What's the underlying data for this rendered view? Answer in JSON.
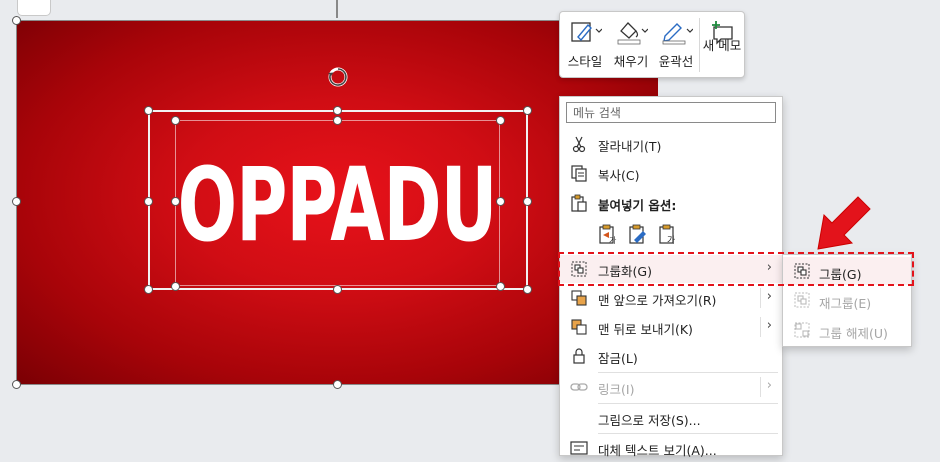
{
  "slide": {
    "title": "OPPADU"
  },
  "mini_toolbar": {
    "style_label": "스타일",
    "fill_label": "채우기",
    "outline_label": "윤곽선",
    "new_note_label": "새 메모"
  },
  "context_menu": {
    "search_placeholder": "메뉴 검색",
    "cut_label": "잘라내기(T)",
    "copy_label": "복사(C)",
    "paste_options_label": "붙여넣기 옵션:",
    "paste_icon_text": "가",
    "group_label": "그룹화(G)",
    "bring_front_label": "맨 앞으로 가져오기(R)",
    "send_back_label": "맨 뒤로 보내기(K)",
    "lock_label": "잠금(L)",
    "link_label": "링크(I)",
    "save_as_picture_label": "그림으로 저장(S)...",
    "alt_text_label": "대체 텍스트 보기(A)..."
  },
  "submenu": {
    "group_label": "그룹(G)",
    "regroup_label": "재그룹(E)",
    "ungroup_label": "그룹 해제(U)"
  },
  "colors": {
    "accent_red": "#e3131b",
    "slide_red": "#d00d14",
    "highlight": "#fbeff0"
  }
}
